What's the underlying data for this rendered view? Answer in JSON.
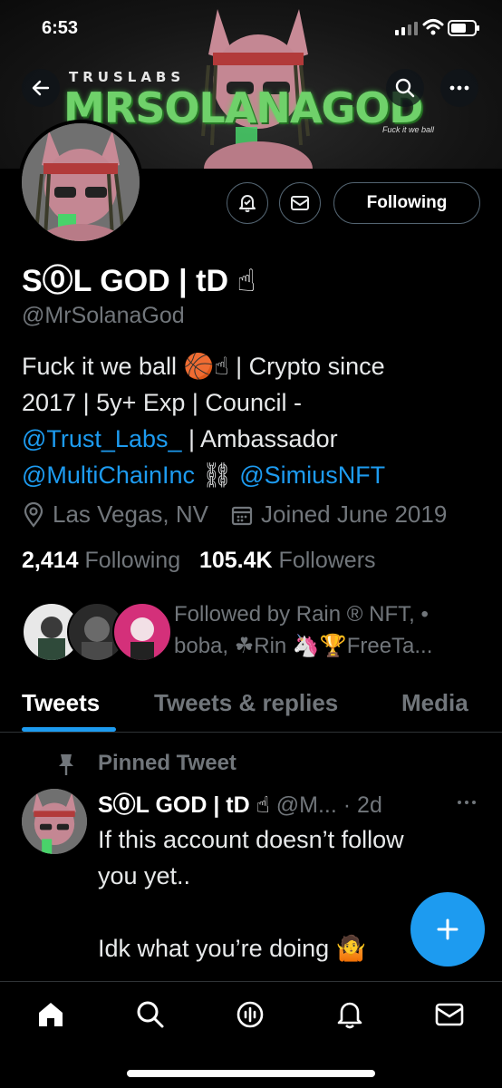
{
  "status_bar": {
    "time": "6:53"
  },
  "banner": {
    "brand": "TRUSLABS",
    "title": "MRSOLANAGOD",
    "motto": "Fuck it we ball"
  },
  "profile": {
    "name": "S⓪L GOD | tD ☝",
    "handle": "@MrSolanaGod",
    "follow_button": "Following",
    "bio_line1": "Fuck it we ball 🏀☝ | Crypto since",
    "bio_line2": "2017 | 5y+ Exp | Council -",
    "bio_link1": "@Trust_Labs_",
    "bio_line3_rest": " | Ambassador",
    "bio_link2": "@MultiChainInc",
    "bio_chain": " ⛓ ",
    "bio_link3": "@SimiusNFT",
    "location": "Las Vegas, NV",
    "joined": "Joined June 2019",
    "following_count": "2,414",
    "following_label": "Following",
    "followers_count": "105.4K",
    "followers_label": "Followers",
    "followed_by_line1": "Followed by Rain ® NFT, •",
    "followed_by_line2": "boba, ☘Rin 🦄🏆FreeTa..."
  },
  "tabs": [
    "Tweets",
    "Tweets & replies",
    "Media"
  ],
  "pinned_tweet": {
    "label": "Pinned Tweet",
    "author_name": "S⓪L GOD | tD ☝",
    "author_meta": "@M... · 2d",
    "text_line1": "If this account doesn’t follow",
    "text_line2": "you yet..",
    "text_line3": "Idk what you’re doing 🤷"
  },
  "colors": {
    "accent": "#1d9bf0",
    "muted": "#71767b",
    "background": "#000000",
    "banner_text": "#6fd16a"
  },
  "icons": [
    "back-arrow-icon",
    "search-icon",
    "more-icon",
    "notification-bell-icon",
    "message-icon",
    "location-icon",
    "calendar-icon",
    "pin-icon",
    "compose-plus-icon",
    "home-icon",
    "explore-icon",
    "spaces-icon",
    "notifications-icon",
    "messages-icon"
  ]
}
